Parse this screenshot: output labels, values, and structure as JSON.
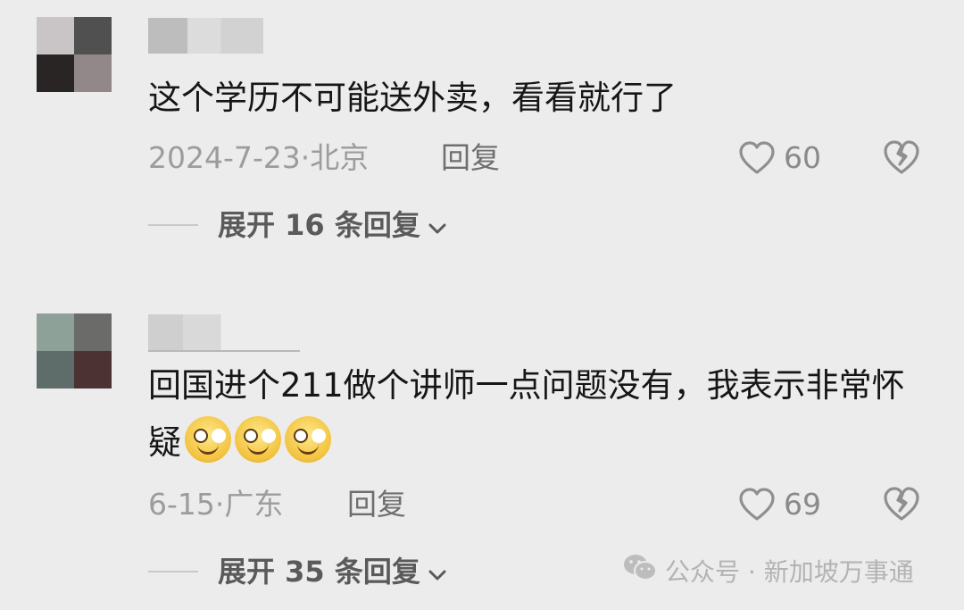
{
  "comments": [
    {
      "text": "这个学历不可能送外卖，看看就行了",
      "date": "2024-7-23",
      "location": "北京",
      "reply_label": "回复",
      "likes": "60",
      "expand_label": "展开 16 条回复",
      "avatar_colors": [
        "#c9c4c6",
        "#505050",
        "#2a2525",
        "#938889"
      ]
    },
    {
      "text": "回国进个211做个讲师一点问题没有，我表示非常怀疑",
      "date": "6-15",
      "location": "广东",
      "reply_label": "回复",
      "likes": "69",
      "expand_label": "展开 35 条回复",
      "avatar_colors": [
        "#8da199",
        "#6b6b69",
        "#5e6d69",
        "#4c3232"
      ]
    }
  ],
  "meta_separator": "·",
  "watermark": "公众号 · 新加坡万事通",
  "icons": {
    "like": "heart-outline-icon",
    "dislike": "broken-heart-icon",
    "expand": "chevron-down-icon",
    "watermark": "wechat-icon"
  },
  "colors": {
    "background": "#ececec",
    "text": "#161616",
    "meta": "#9c9c9c"
  }
}
